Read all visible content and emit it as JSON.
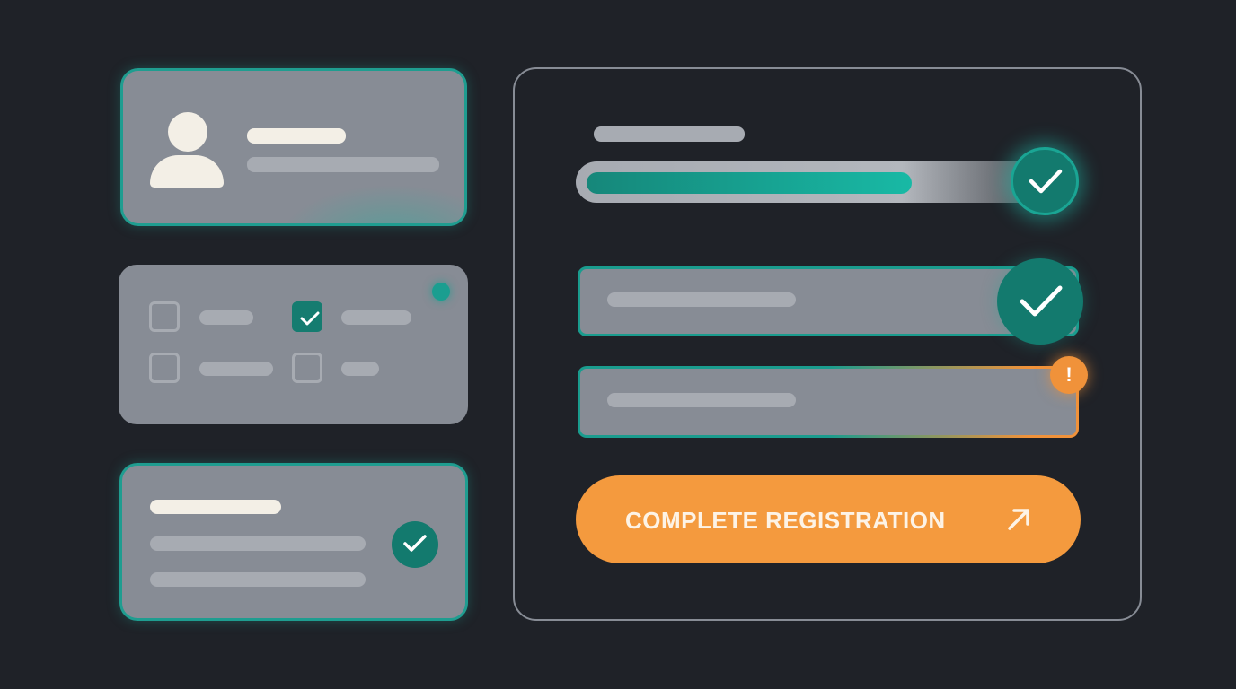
{
  "form": {
    "submit_label": "COMPLETE REGISTRATION",
    "progress": 0.73,
    "field_states": [
      "valid",
      "warning"
    ],
    "warning_glyph": "!"
  },
  "checkboxes": [
    {
      "checked": false
    },
    {
      "checked": true
    },
    {
      "checked": false
    },
    {
      "checked": false
    }
  ],
  "colors": {
    "background": "#1f2228",
    "card": "#878c95",
    "accent_teal": "#1a9c8e",
    "accent_orange": "#f49a3e"
  },
  "icons": [
    "user-icon",
    "check-icon",
    "warning-icon",
    "arrow-up-right-icon"
  ]
}
